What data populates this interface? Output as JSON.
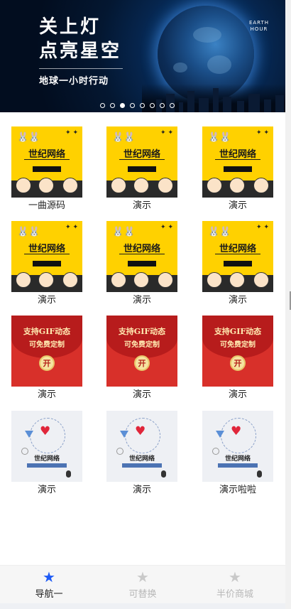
{
  "banner": {
    "title_line1": "关上灯",
    "title_line2": "点亮星空",
    "subtitle": "地球一小时行动",
    "badge_line1": "EARTH",
    "badge_line2": "HOUR",
    "slide_count": 8,
    "active_slide": 3
  },
  "items": [
    {
      "label": "一曲源码",
      "thumb": "yellow-cartoon",
      "thumb_title": "世纪网络"
    },
    {
      "label": "演示",
      "thumb": "yellow-cartoon",
      "thumb_title": "世纪网络"
    },
    {
      "label": "演示",
      "thumb": "yellow-cartoon",
      "thumb_title": "世纪网络"
    },
    {
      "label": "演示",
      "thumb": "yellow-cartoon",
      "thumb_title": "世纪网络"
    },
    {
      "label": "演示",
      "thumb": "yellow-cartoon",
      "thumb_title": "世纪网络"
    },
    {
      "label": "演示",
      "thumb": "yellow-cartoon",
      "thumb_title": "世纪网络"
    },
    {
      "label": "演示",
      "thumb": "red-envelope",
      "thumb_line1": "支持GIF动态",
      "thumb_line2": "可免费定制",
      "coin": "开"
    },
    {
      "label": "演示",
      "thumb": "red-envelope",
      "thumb_line1": "支持GIF动态",
      "thumb_line2": "可免费定制",
      "coin": "开"
    },
    {
      "label": "演示",
      "thumb": "red-envelope",
      "thumb_line1": "支持GIF动态",
      "thumb_line2": "可免费定制",
      "coin": "开"
    },
    {
      "label": "演示",
      "thumb": "heart-refresh",
      "thumb_title": "世纪网络"
    },
    {
      "label": "演示",
      "thumb": "heart-refresh",
      "thumb_title": "世纪网络"
    },
    {
      "label": "演示啦啦",
      "thumb": "heart-refresh",
      "thumb_title": "世纪网络"
    }
  ],
  "tabbar": {
    "tabs": [
      {
        "label": "导航一",
        "icon": "star-icon",
        "active": true
      },
      {
        "label": "可替换",
        "icon": "star-icon",
        "active": false
      },
      {
        "label": "半价商城",
        "icon": "star-icon",
        "active": false
      }
    ],
    "active_color": "#1e5bf6",
    "inactive_color": "#c9c9c9"
  }
}
